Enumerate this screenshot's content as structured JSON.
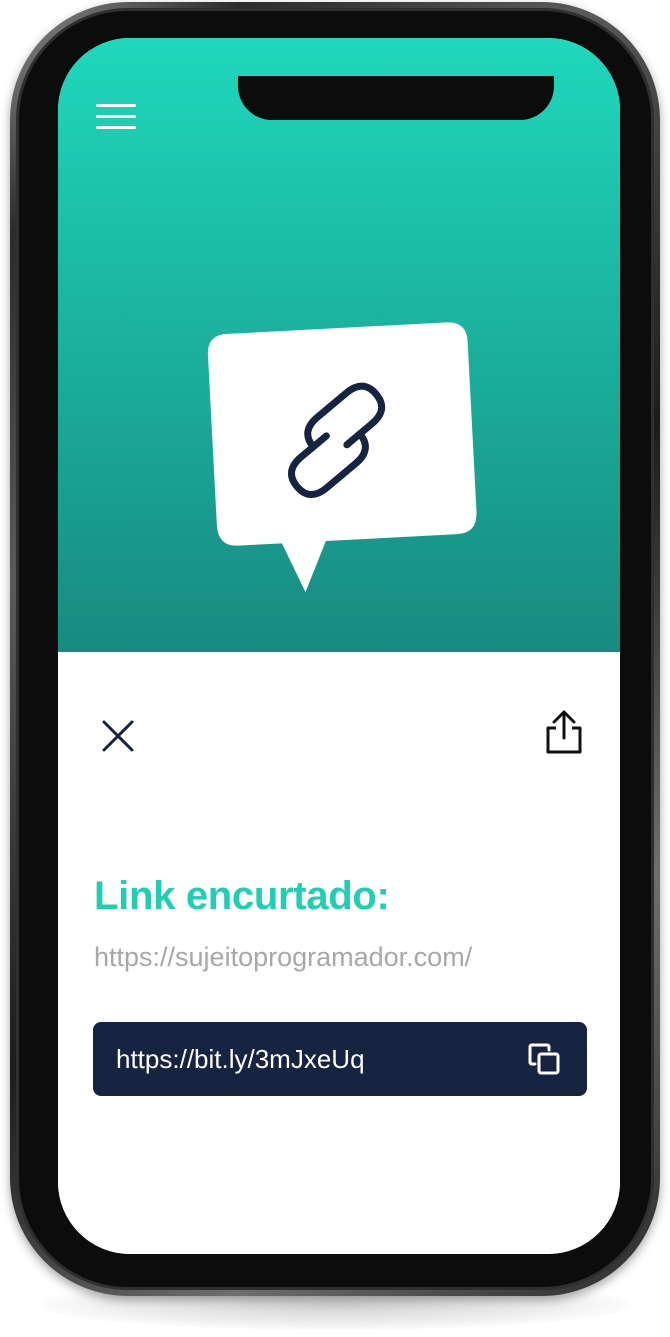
{
  "header": {
    "menu_icon": "hamburger-menu-icon",
    "logo_icon": "link-chain-icon"
  },
  "sheet": {
    "close_icon": "close-icon",
    "share_icon": "share-icon",
    "title": "Link encurtado:",
    "original_url": "https://sujeitoprogramador.com/",
    "short_link": "https://bit.ly/3mJxeUq",
    "copy_icon": "copy-icon"
  },
  "colors": {
    "hero_top": "#1fd8bb",
    "hero_bottom": "#178a80",
    "accent": "#1fcfb1",
    "link_bar": "#172441",
    "logo_stroke": "#172441",
    "muted_text": "#a8a8a8"
  }
}
